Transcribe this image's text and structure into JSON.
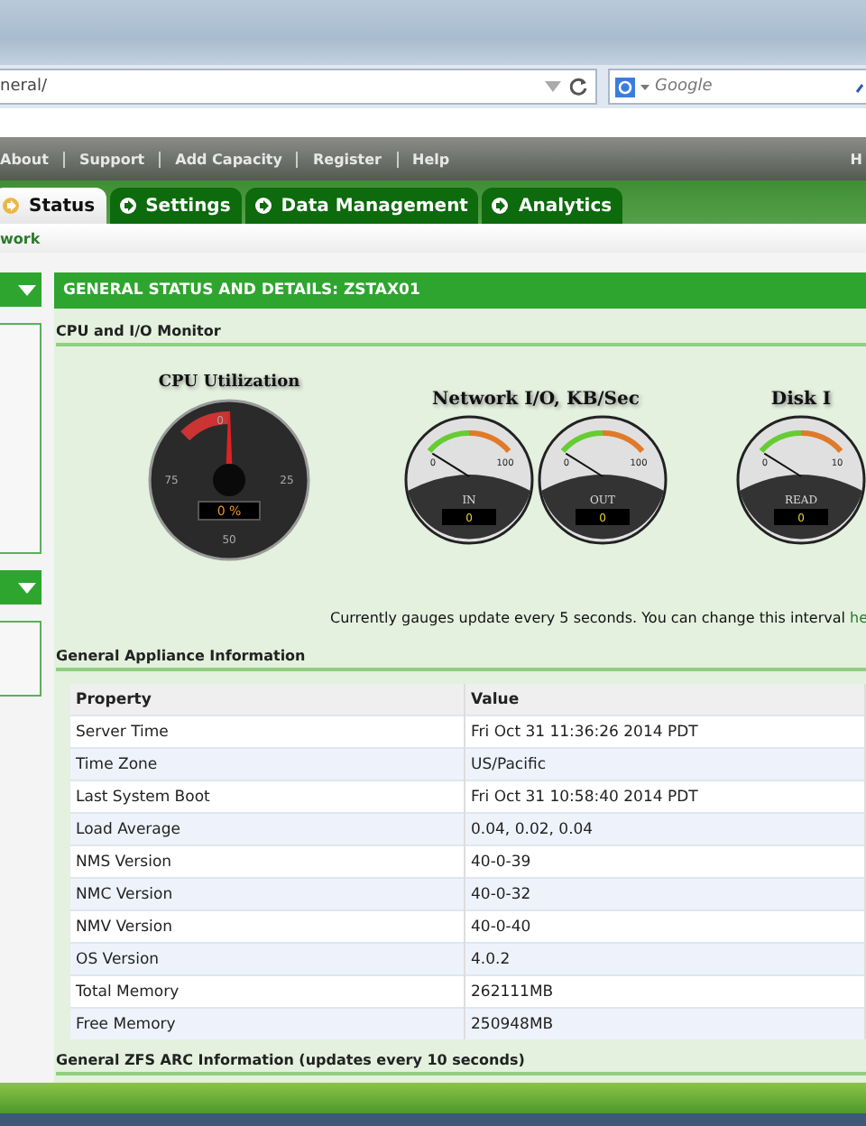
{
  "browser": {
    "address": "neral/",
    "search_placeholder": "Google"
  },
  "top_menu": [
    "About",
    "Support",
    "Add Capacity",
    "Register",
    "Help"
  ],
  "top_menu_right": "H",
  "tabs": [
    {
      "label": "Status",
      "selected": true
    },
    {
      "label": "Settings",
      "selected": false
    },
    {
      "label": "Data Management",
      "selected": false
    },
    {
      "label": "Analytics",
      "selected": false
    }
  ],
  "breadcrumb": "work",
  "panel": {
    "title": "GENERAL STATUS AND DETAILS: ZSTAX01",
    "monitor_heading": "CPU and I/O Monitor",
    "gauge_groups": [
      {
        "title": "CPU Utilization",
        "gauges": [
          {
            "kind": "dial",
            "ticks": [
              "0",
              "25",
              "50",
              "75"
            ],
            "reading": "0 %"
          }
        ]
      },
      {
        "title": "Network I/O, KB/Sec",
        "gauges": [
          {
            "kind": "meter",
            "min": "0",
            "max": "100",
            "label": "IN",
            "reading": "0"
          },
          {
            "kind": "meter",
            "min": "0",
            "max": "100",
            "label": "OUT",
            "reading": "0"
          }
        ]
      },
      {
        "title": "Disk I",
        "gauges": [
          {
            "kind": "meter",
            "min": "0",
            "max": "10",
            "label": "READ",
            "reading": "0"
          }
        ]
      }
    ],
    "update_note": "Currently gauges update every 5 seconds. You can change this interval",
    "update_link": "he",
    "info_heading": "General Appliance Information",
    "table": {
      "columns": [
        "Property",
        "Value"
      ],
      "rows": [
        [
          "Server Time",
          "Fri Oct 31 11:36:26 2014 PDT"
        ],
        [
          "Time Zone",
          "US/Pacific"
        ],
        [
          "Last System Boot",
          "Fri Oct 31 10:58:40 2014 PDT"
        ],
        [
          "Load Average",
          "0.04, 0.02, 0.04"
        ],
        [
          "NMS Version",
          "40-0-39"
        ],
        [
          "NMC Version",
          "40-0-32"
        ],
        [
          "NMV Version",
          "40-0-40"
        ],
        [
          "OS Version",
          "4.0.2"
        ],
        [
          "Total Memory",
          "262111MB"
        ],
        [
          "Free Memory",
          "250948MB"
        ]
      ]
    },
    "arc_heading": "General ZFS ARC Information (updates every 10 seconds)"
  }
}
